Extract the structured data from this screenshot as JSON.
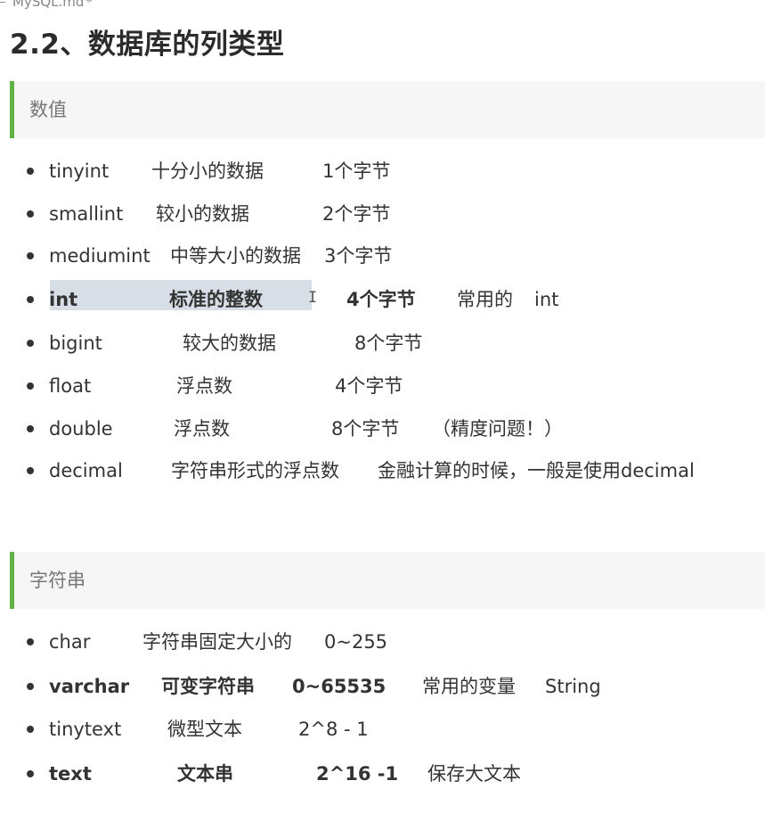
{
  "tab": {
    "title": "MySQL.md",
    "dirty_marker": "*"
  },
  "heading": "2.2、数据库的列类型",
  "sections": [
    {
      "title": "数值",
      "items": [
        {
          "cells": [
            "tinyint",
            "十分小的数据",
            "1个字节"
          ]
        },
        {
          "cells": [
            "smallint",
            "较小的数据",
            "2个字节"
          ]
        },
        {
          "cells": [
            "mediumint",
            "中等大小的数据",
            "3个字节"
          ]
        },
        {
          "cells": [
            "int",
            "标准的整数",
            "4个字节",
            "常用的",
            "int"
          ],
          "emphasis": "bold",
          "highlighted": true
        },
        {
          "cells": [
            "bigint",
            "较大的数据",
            "8个字节"
          ]
        },
        {
          "cells": [
            "float",
            "浮点数",
            "4个字节"
          ]
        },
        {
          "cells": [
            "double",
            "浮点数",
            "8个字节",
            "（精度问题！）"
          ]
        },
        {
          "cells": [
            "decimal",
            "字符串形式的浮点数",
            "金融计算的时候，一般是使用decimal"
          ]
        }
      ]
    },
    {
      "title": "字符串",
      "items": [
        {
          "cells": [
            "char",
            "字符串固定大小的",
            "0~255"
          ]
        },
        {
          "cells": [
            "varchar",
            "可变字符串",
            "0~65535",
            "常用的变量",
            "String"
          ],
          "emphasis": "bold"
        },
        {
          "cells": [
            "tinytext",
            "微型文本",
            "2^8 - 1"
          ]
        },
        {
          "cells": [
            "text",
            "文本串",
            "2^16 -1",
            "保存大文本"
          ],
          "emphasis": "bold"
        }
      ]
    }
  ]
}
